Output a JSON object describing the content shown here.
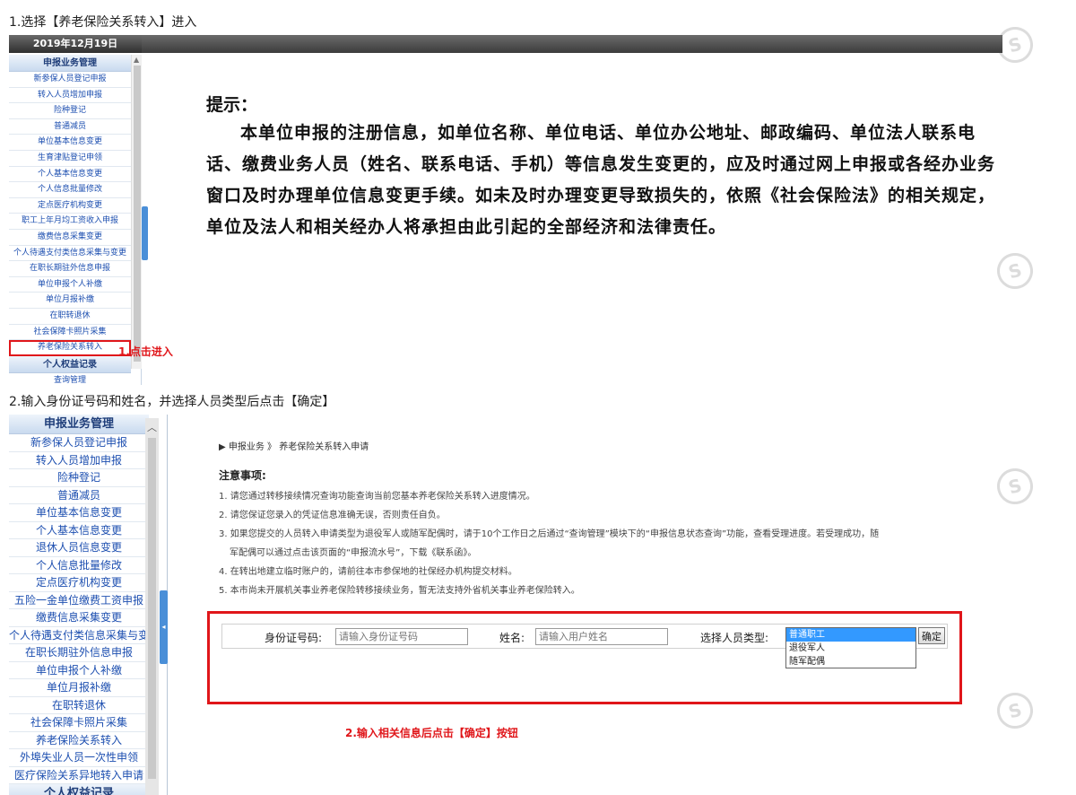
{
  "steps": {
    "step1_title": "1.选择【养老保险关系转入】进入",
    "step2_title": "2.输入身份证号码和姓名，并选择人员类型后点击【确定】"
  },
  "screen1": {
    "date": "2019年12月19日",
    "menu_head": "申报业务管理",
    "menu_items": [
      "新参保人员登记申报",
      "转入人员增加申报",
      "险种登记",
      "普通减员",
      "单位基本信息变更",
      "生育津贴登记申领",
      "个人基本信息变更",
      "个人信息批量修改",
      "定点医疗机构变更",
      "职工上年月均工资收入申报",
      "缴费信息采集变更",
      "个人待遇支付类信息采集与变更",
      "在职长期驻外信息申报",
      "单位申报个人补缴",
      "单位月报补缴",
      "在职转退休",
      "社会保障卡照片采集",
      "养老保险关系转入"
    ],
    "menu_head2": "个人权益记录",
    "menu_partial": "查询管理",
    "annotation": "1.点击进入",
    "tip_head": "提示：",
    "tip_body": "本单位申报的注册信息，如单位名称、单位电话、单位办公地址、邮政编码、单位法人联系电话、缴费业务人员（姓名、联系电话、手机）等信息发生变更的，应及时通过网上申报或各经办业务窗口及时办理单位信息变更手续。如未及时办理变更导致损失的，依照《社会保险法》的相关规定，单位及法人和相关经办人将承担由此引起的全部经济和法律责任。"
  },
  "screen2": {
    "menu_head": "申报业务管理",
    "menu_items": [
      "新参保人员登记申报",
      "转入人员增加申报",
      "险种登记",
      "普通减员",
      "单位基本信息变更",
      "个人基本信息变更",
      "退休人员信息变更",
      "个人信息批量修改",
      "定点医疗机构变更",
      "五险一金单位缴费工资申报",
      "缴费信息采集变更",
      "个人待遇支付类信息采集与变更",
      "在职长期驻外信息申报",
      "单位申报个人补缴",
      "单位月报补缴",
      "在职转退休",
      "社会保障卡照片采集",
      "养老保险关系转入",
      "外埠失业人员一次性申领",
      "医疗保险关系异地转入申请"
    ],
    "menu_head2": "个人权益记录",
    "breadcrumb": "▶ 申报业务 》 养老保险关系转入申请",
    "notice_title": "注意事项:",
    "notices": [
      "1. 请您通过转移接续情况查询功能查询当前您基本养老保险关系转入进度情况。",
      "2. 请您保证您录入的凭证信息准确无误，否则责任自负。",
      "3. 如果您提交的人员转入申请类型为退役军人或随军配偶时，请于10个工作日之后通过“查询管理”模块下的“申报信息状态查询”功能，查看受理进度。若受理成功，随",
      "军配偶可以通过点击该页面的“申报流水号”，下载《联系函》。",
      "4. 在转出地建立临时账户的，请前往本市参保地的社保经办机构提交材料。",
      "5. 本市尚未开展机关事业养老保险转移接续业务，暂无法支持外省机关事业养老保险转入。"
    ],
    "form": {
      "id_label": "身份证号码:",
      "id_placeholder": "请输入身份证号码",
      "name_label": "姓名:",
      "name_placeholder": "请输入用户姓名",
      "type_label": "选择人员类型:",
      "type_options": [
        "普通职工",
        "退役军人",
        "随军配偶"
      ],
      "type_selected": "普通职工",
      "ok_label": "确定"
    },
    "annotation": "2.输入相关信息后点击【确定】按钮"
  },
  "colors": {
    "annotation_red": "#e0161a",
    "menu_link": "#1d4fb0",
    "selected_option": "#3399ff"
  }
}
